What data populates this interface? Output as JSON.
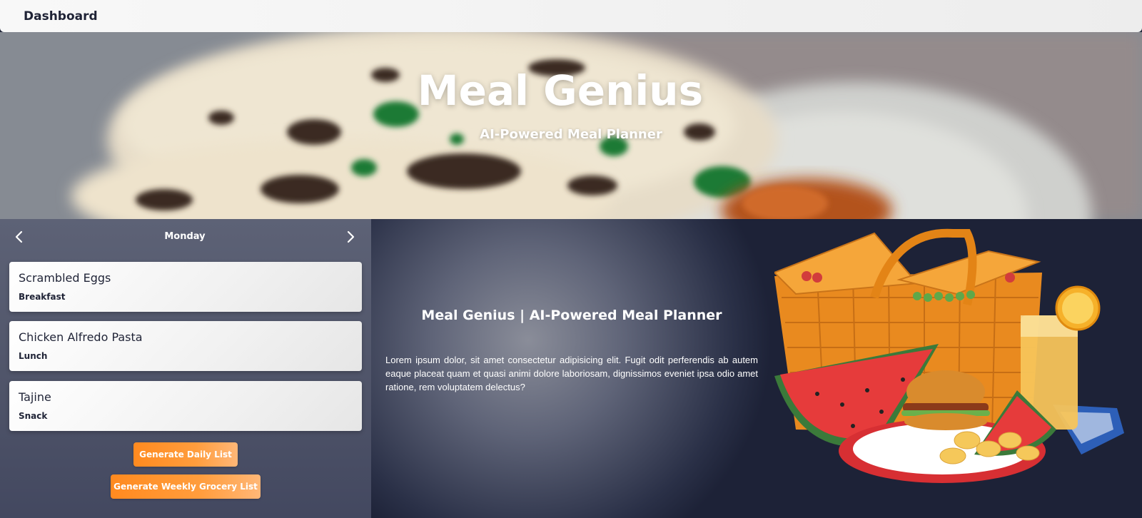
{
  "nav": {
    "title": "Dashboard"
  },
  "hero": {
    "title": "Meal Genius",
    "subtitle": "AI-Powered Meal Planner",
    "background_image": "flatbread-on-plate"
  },
  "planner": {
    "day": "Monday",
    "prev_icon": "chevron-left-icon",
    "next_icon": "chevron-right-icon",
    "meals": [
      {
        "name": "Scrambled Eggs",
        "type": "Breakfast"
      },
      {
        "name": "Chicken Alfredo Pasta",
        "type": "Lunch"
      },
      {
        "name": "Tajine",
        "type": "Snack"
      }
    ],
    "buttons": {
      "daily": "Generate Daily List",
      "weekly": "Generate Weekly Grocery List"
    }
  },
  "info": {
    "title": "Meal Genius | AI-Powered Meal Planner",
    "description": "Lorem ipsum dolor, sit amet consectetur adipisicing elit. Fugit odit perferendis ab autem eaque placeat quam et quasi animi dolore laboriosam, dignissimos eveniet ipsa odio amet ratione, rem voluptatem delectus?"
  },
  "illustration": {
    "subject": "picnic-basket-illustration"
  },
  "colors": {
    "accent": "#ff9a33",
    "dark_bg": "#1d2237",
    "card_bg": "#f1f1f1",
    "text_dark": "#1f2336"
  }
}
